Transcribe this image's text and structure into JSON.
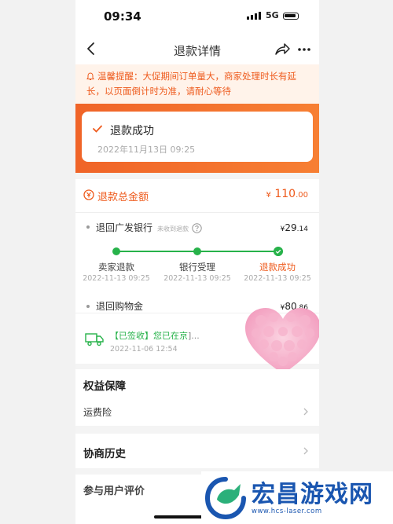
{
  "status_bar": {
    "time": "09:34",
    "network": "5G"
  },
  "nav": {
    "title": "退款详情"
  },
  "tip": {
    "text": "温馨提醒：大促期间订单量大，商家处理时长有延长，以页面倒计时为准，请耐心等待"
  },
  "refund_status": {
    "title": "退款成功",
    "time": "2022年11月13日 09:25"
  },
  "refund_total": {
    "label": "退款总金额",
    "currency": "¥",
    "amount_int": "110",
    "amount_dec": ".00"
  },
  "bank_refund": {
    "label": "退回广发银行",
    "sub": "未收到退款",
    "currency": "¥",
    "amount_int": "29",
    "amount_dec": ".14",
    "steps": [
      {
        "label": "卖家退款",
        "time": "2022-11-13 09:25"
      },
      {
        "label": "银行受理",
        "time": "2022-11-13 09:25"
      },
      {
        "label": "退款成功",
        "time": "2022-11-13 09:25"
      }
    ]
  },
  "gold_refund": {
    "label": "退回购物金",
    "currency": "¥",
    "amount_int": "80",
    "amount_dec": ".86"
  },
  "logistics": {
    "text": "【已签收】您已在京",
    "suffix": "]...",
    "time": "2022-11-06 12:54"
  },
  "protection": {
    "title": "权益保障",
    "item": "运费险"
  },
  "history": {
    "title": "协商历史"
  },
  "cut_section": {
    "text": "参与用户评价"
  },
  "watermark": {
    "title": "宏昌游戏网",
    "url": "www.hcs-laser.com"
  },
  "colors": {
    "accent": "#ee5a1c",
    "green": "#27b24a",
    "brand_blue": "#1a56b0"
  }
}
